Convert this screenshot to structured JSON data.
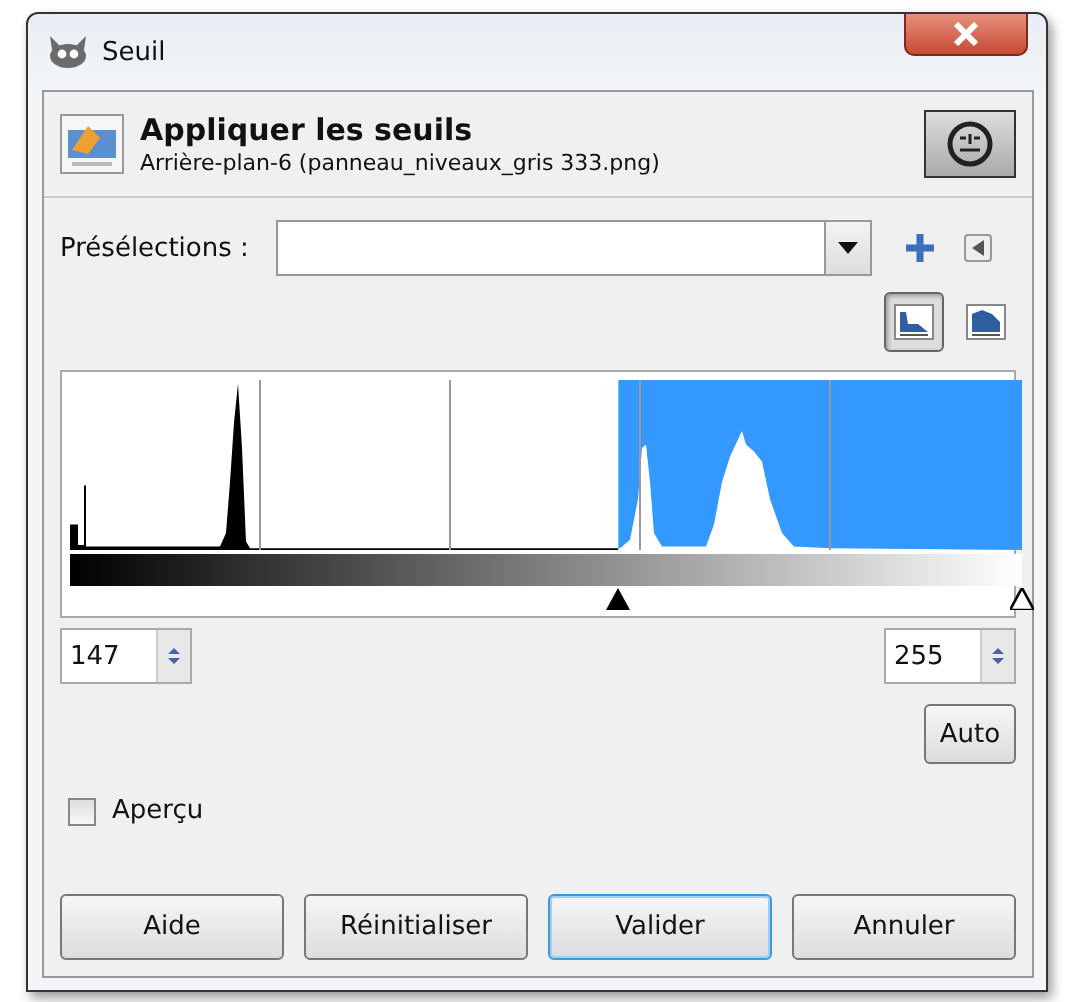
{
  "window": {
    "title": "Seuil"
  },
  "header": {
    "title": "Appliquer les seuils",
    "subtitle": "Arrière-plan-6 (panneau_niveaux_gris 333.png)"
  },
  "presets": {
    "label": "Présélections :"
  },
  "histogram_modes": [
    {
      "kind": "linear",
      "selected": true
    },
    {
      "kind": "logarithmic",
      "selected": false
    }
  ],
  "thresholds": [
    {
      "value": "147",
      "level": 0.576
    },
    {
      "value": "255",
      "level": 1
    }
  ],
  "auto_button": "Auto",
  "preview": {
    "label": "Aperçu",
    "checked": false
  },
  "buttons": [
    {
      "label": "Aide",
      "focused": false
    },
    {
      "label": "Réinitialiser",
      "focused": false
    },
    {
      "label": "Valider",
      "focused": true
    },
    {
      "label": "Annuler",
      "focused": false
    }
  ]
}
